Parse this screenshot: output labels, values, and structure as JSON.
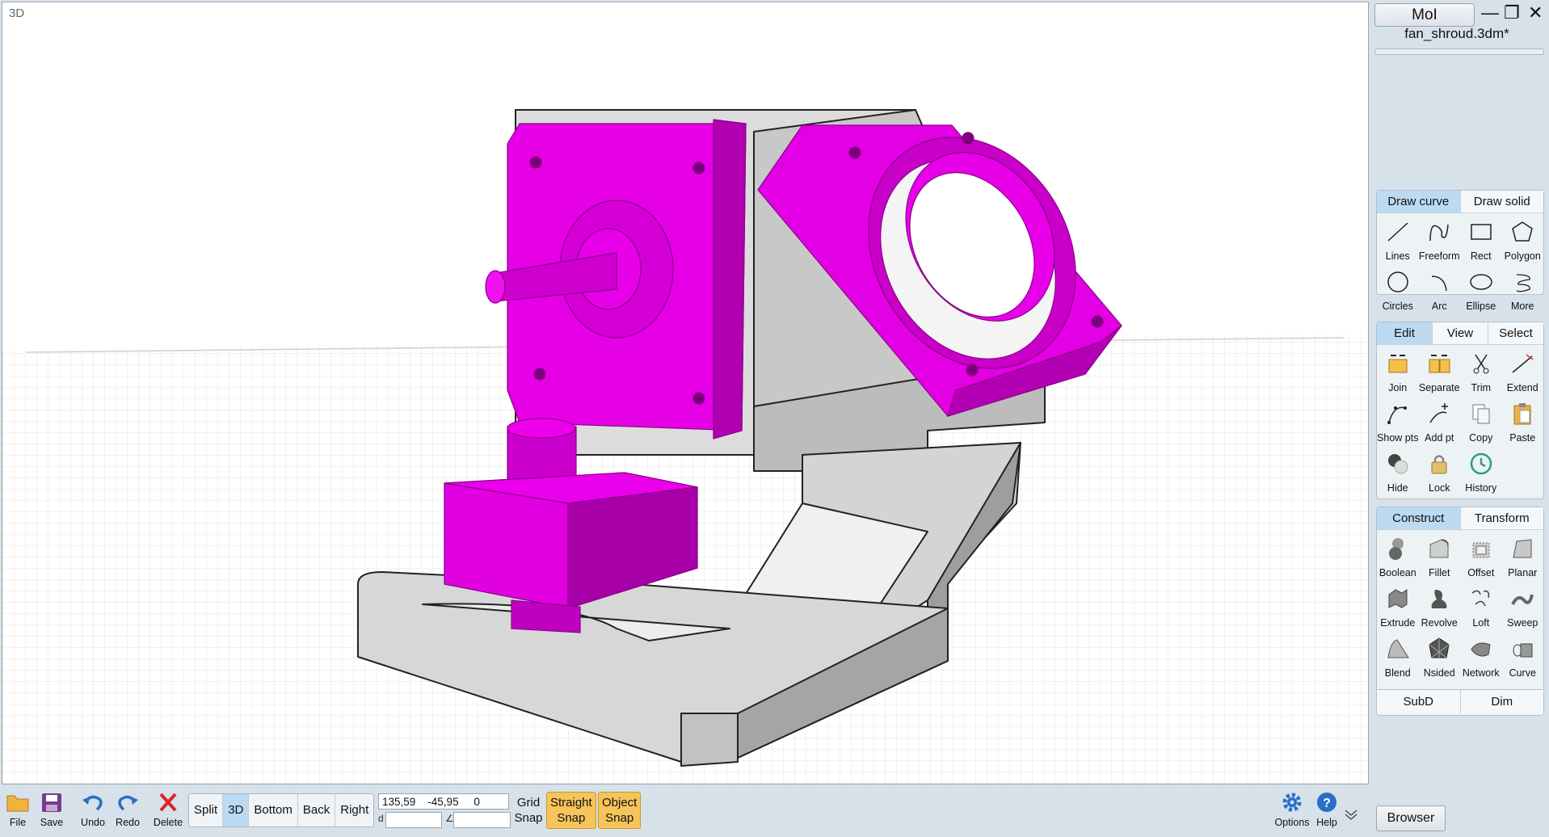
{
  "app": {
    "title": "MoI",
    "filename": "fan_shroud.3dm*"
  },
  "viewport": {
    "label": "3D"
  },
  "draw_curve_group": {
    "tabs": [
      "Draw curve",
      "Draw solid"
    ],
    "tools": [
      "Lines",
      "Freeform",
      "Rect",
      "Polygon",
      "Circles",
      "Arc",
      "Ellipse",
      "More"
    ]
  },
  "edit_group": {
    "tabs": [
      "Edit",
      "View",
      "Select"
    ],
    "tools": [
      "Join",
      "Separate",
      "Trim",
      "Extend",
      "Show pts",
      "Add pt",
      "Copy",
      "Paste",
      "Hide",
      "Lock",
      "History"
    ]
  },
  "construct_group": {
    "tabs": [
      "Construct",
      "Transform"
    ],
    "tools": [
      "Boolean",
      "Fillet",
      "Offset",
      "Planar",
      "Extrude",
      "Revolve",
      "Loft",
      "Sweep",
      "Blend",
      "Nsided",
      "Network",
      "Curve"
    ]
  },
  "bottom_group": {
    "tabs": [
      "SubD",
      "Dim"
    ]
  },
  "toolbar": {
    "file": "File",
    "save": "Save",
    "undo": "Undo",
    "redo": "Redo",
    "delete": "Delete",
    "views": [
      "Split",
      "3D",
      "Bottom",
      "Back",
      "Right"
    ],
    "coords": "135,59    -45,95     0",
    "d_label": "d",
    "angle_label": "∠",
    "grid_snap": [
      "Grid",
      "Snap"
    ],
    "straight_snap": [
      "Straight",
      "Snap"
    ],
    "object_snap": [
      "Object",
      "Snap"
    ],
    "options": "Options",
    "help": "Help",
    "browser": "Browser"
  },
  "colors": {
    "accent_tab": "#bcdaf2",
    "snap_active": "#f6c45a",
    "object_highlight": "#e100e1"
  }
}
